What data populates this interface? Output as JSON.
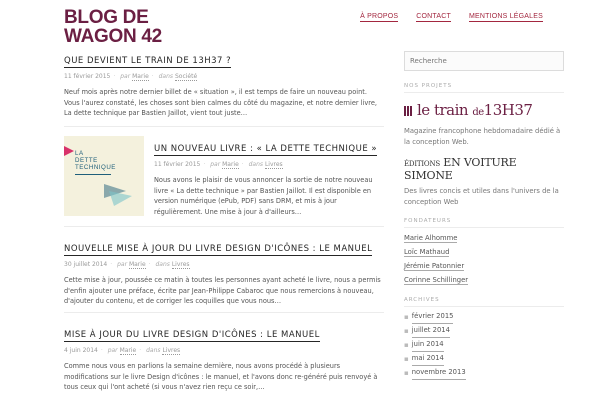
{
  "site": {
    "title": "BLOG DE WAGON 42"
  },
  "nav": {
    "items": [
      "À PROPOS",
      "CONTACT",
      "MENTIONS LÉGALES"
    ]
  },
  "posts": [
    {
      "title": "QUE DEVIENT LE TRAIN DE 13H37 ?",
      "date": "11 février 2015",
      "author_prefix": "par",
      "author": "Marie",
      "category_prefix": "dans",
      "category": "Société",
      "excerpt": "Neuf mois après notre dernier billet de « situation », il est temps de faire un nouveau point. Vous l'aurez constaté, les choses sont bien calmes du côté du magazine, et notre dernier livre, La dette technique par Bastien Jaillot, vient tout juste…"
    },
    {
      "title": "UN NOUVEAU LIVRE : « LA DETTE TECHNIQUE »",
      "date": "11 février 2015",
      "author_prefix": "par",
      "author": "Marie",
      "category_prefix": "dans",
      "category": "Livres",
      "excerpt": "Nous avons le plaisir de vous annoncer la sortie de notre nouveau livre « La dette technique » par Bastien Jaillot. Il est disponible en version numérique (ePub, PDF) sans DRM, et mis à jour régulièrement. Une mise à jour à d'ailleurs…",
      "cover_lines": [
        "LA",
        "DETTE",
        "TECHNIQUE"
      ]
    },
    {
      "title": "NOUVELLE MISE À JOUR DU LIVRE DESIGN D'ICÔNES : LE MANUEL",
      "date": "30 juillet 2014",
      "author_prefix": "par",
      "author": "Marie",
      "category_prefix": "dans",
      "category": "Livres",
      "excerpt": "Cette mise à jour, poussée ce matin à toutes les personnes ayant acheté le livre, nous a permis d'enfin ajouter une préface, écrite par Jean-Philippe Cabaroc que nous remercions à nouveau, d'ajouter du contenu, et de corriger les coquilles que vous nous…"
    },
    {
      "title": "MISE À JOUR DU LIVRE DESIGN D'ICÔNES : LE MANUEL",
      "date": "4 juin 2014",
      "author_prefix": "par",
      "author": "Marie",
      "category_prefix": "dans",
      "category": "Livres",
      "excerpt": "Comme nous vous en parlions la semaine dernière, nous avons procédé à plusieurs modifications sur le livre Design d'icônes : le manuel, et l'avons donc re-généré puis renvoyé à tous ceux qui l'ont acheté (si vous n'avez rien reçu ce soir,…"
    }
  ],
  "sidebar": {
    "search_placeholder": "Recherche",
    "projects_title": "NOS PROJETS",
    "train_logo": {
      "a": "le train",
      "b": "de",
      "c": "13H37"
    },
    "train_desc": "Magazine francophone hebdomadaire dédié à la conception Web.",
    "vs_logo": {
      "a": "ÉDITIONS",
      "b": "EN VOITURE SIMONE"
    },
    "vs_desc": "Des livres concis et utiles dans l'univers de la conception Web",
    "founders_title": "FONDATEURS",
    "founders": [
      "Marie Alhomme",
      "Loïc Mathaud",
      "Jérémie Patonnier",
      "Corinne Schillinger"
    ],
    "archives_title": "ARCHIVES",
    "archives": [
      "février 2015",
      "juillet 2014",
      "juin 2014",
      "mai 2014",
      "novembre 2013"
    ]
  },
  "colors": {
    "brand": "#6b1f43",
    "accent": "#a3273f",
    "cover_bg": "#f4f1dd"
  }
}
